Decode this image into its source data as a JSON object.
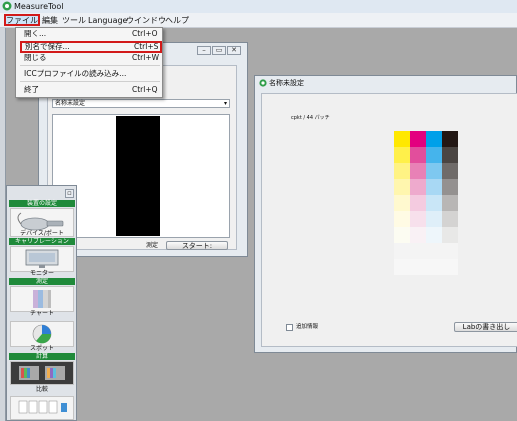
{
  "app": {
    "title": "MeasureTool"
  },
  "menubar": {
    "items": [
      "ファイル",
      "編集",
      "ツール",
      "Language",
      "ウインドウ",
      "ヘルプ"
    ]
  },
  "file_menu": {
    "items": [
      {
        "label": "開く...",
        "shortcut": "Ctrl+O"
      },
      {
        "label": "別名で保存...",
        "shortcut": "Ctrl+S",
        "highlighted": true
      },
      {
        "label": "閉じる",
        "shortcut": "Ctrl+W"
      },
      {
        "label": "ICCプロファイルの読み込み...",
        "shortcut": ""
      },
      {
        "label": "終了",
        "shortcut": "Ctrl+Q"
      }
    ]
  },
  "measure_window": {
    "select_value": "名称未設定",
    "measure_label": "測定",
    "start_button": "スタート:"
  },
  "palette": {
    "sections": [
      {
        "header": "装置の設定",
        "tool": "デバイス/ポート"
      },
      {
        "header": "キャリブレーション",
        "tool": "モニター"
      },
      {
        "header": "測定",
        "tool": "チャート"
      },
      {
        "header": "",
        "tool": "スポット"
      },
      {
        "header": "計算",
        "tool": "比較"
      }
    ]
  },
  "chart_window": {
    "title": "名称未設定",
    "patch_info": "cpkt / 44 パッチ",
    "checkbox_label": "追加情報",
    "lab_button": "Labの書き出し",
    "ink_columns": [
      {
        "name": "yellow",
        "colors": [
          "#ffe800",
          "#fff04a",
          "#fff384",
          "#fff6ae",
          "#fff9cf",
          "#fffbe4",
          "#fcfcf2"
        ]
      },
      {
        "name": "magenta",
        "colors": [
          "#e3007f",
          "#e24e9c",
          "#e881b6",
          "#eeaacd",
          "#f4cbe0",
          "#f7e0ec",
          "#f9f1f5"
        ]
      },
      {
        "name": "cyan",
        "colors": [
          "#00a0e9",
          "#45b4ec",
          "#7ec8f0",
          "#a8d8f4",
          "#c9e6f7",
          "#dfeff9",
          "#eef6fb"
        ]
      },
      {
        "name": "black",
        "colors": [
          "#231815",
          "#4a4542",
          "#6f6b69",
          "#949190",
          "#b8b6b5",
          "#d4d3d2",
          "#e8e8e7"
        ]
      }
    ]
  },
  "colors": {
    "accent_red": "#d21a1a",
    "palette_green": "#1f8a3a"
  }
}
